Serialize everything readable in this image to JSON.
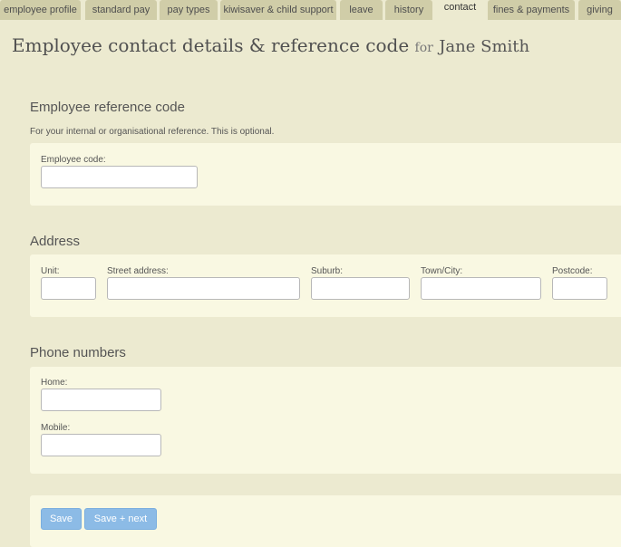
{
  "tabs": [
    {
      "label": "employee profile"
    },
    {
      "label": "standard pay"
    },
    {
      "label": "pay types"
    },
    {
      "label": "kiwisaver & child support"
    },
    {
      "label": "leave"
    },
    {
      "label": "history"
    },
    {
      "label": "contact",
      "active": true
    },
    {
      "label": "fines & payments"
    },
    {
      "label": "giving"
    }
  ],
  "page": {
    "title": "Employee contact details & reference code",
    "for_word": "for",
    "employee_name": "Jane Smith"
  },
  "reference": {
    "title": "Employee reference code",
    "description": "For your internal or organisational reference. This is optional.",
    "code_label": "Employee code:",
    "code_value": ""
  },
  "address": {
    "title": "Address",
    "unit_label": "Unit:",
    "street_label": "Street address:",
    "suburb_label": "Suburb:",
    "city_label": "Town/City:",
    "postcode_label": "Postcode:",
    "unit_value": "",
    "street_value": "",
    "suburb_value": "",
    "city_value": "",
    "postcode_value": ""
  },
  "phone": {
    "title": "Phone numbers",
    "home_label": "Home:",
    "mobile_label": "Mobile:",
    "home_value": "",
    "mobile_value": ""
  },
  "actions": {
    "save_label": "Save",
    "save_next_label": "Save + next"
  },
  "colors": {
    "page_background": "#ecead0",
    "panel_background": "#f9f8e2",
    "tab_background": "#d0cda8",
    "button_blue": "#8cbbe6"
  }
}
